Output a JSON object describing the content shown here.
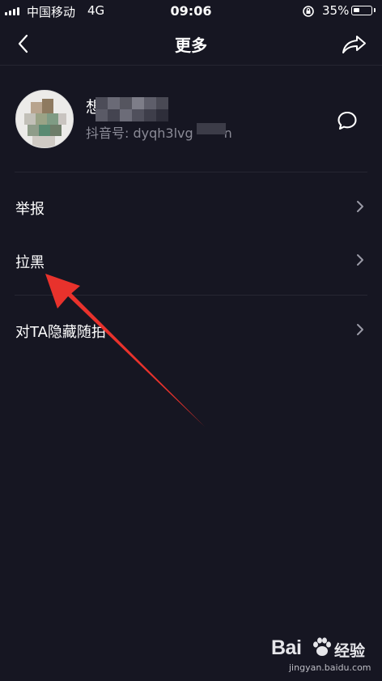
{
  "status_bar": {
    "carrier": "中国移动",
    "network": "4G",
    "time": "09:06",
    "battery_percent": "35%",
    "battery_level": 0.35
  },
  "nav": {
    "title": "更多",
    "back_icon": "chevron-left-icon",
    "share_icon": "share-icon"
  },
  "profile": {
    "name_visible": "想",
    "douyin_id_label": "抖音号: dyqh3lvg",
    "douyin_id_tail": "n",
    "message_icon": "message-bubble-icon"
  },
  "menu": {
    "items": [
      {
        "label": "举报"
      },
      {
        "label": "拉黑"
      },
      {
        "label": "对TA隐藏随拍"
      }
    ],
    "chevron_icon": "chevron-right-icon"
  },
  "annotation": {
    "arrow_color": "#e8322c"
  },
  "watermark": {
    "brand": "Bai",
    "product": "经验",
    "url": "jingyan.baidu.com"
  },
  "colors": {
    "background": "#161622",
    "divider": "#262632",
    "secondary_text": "#8a8a96"
  }
}
